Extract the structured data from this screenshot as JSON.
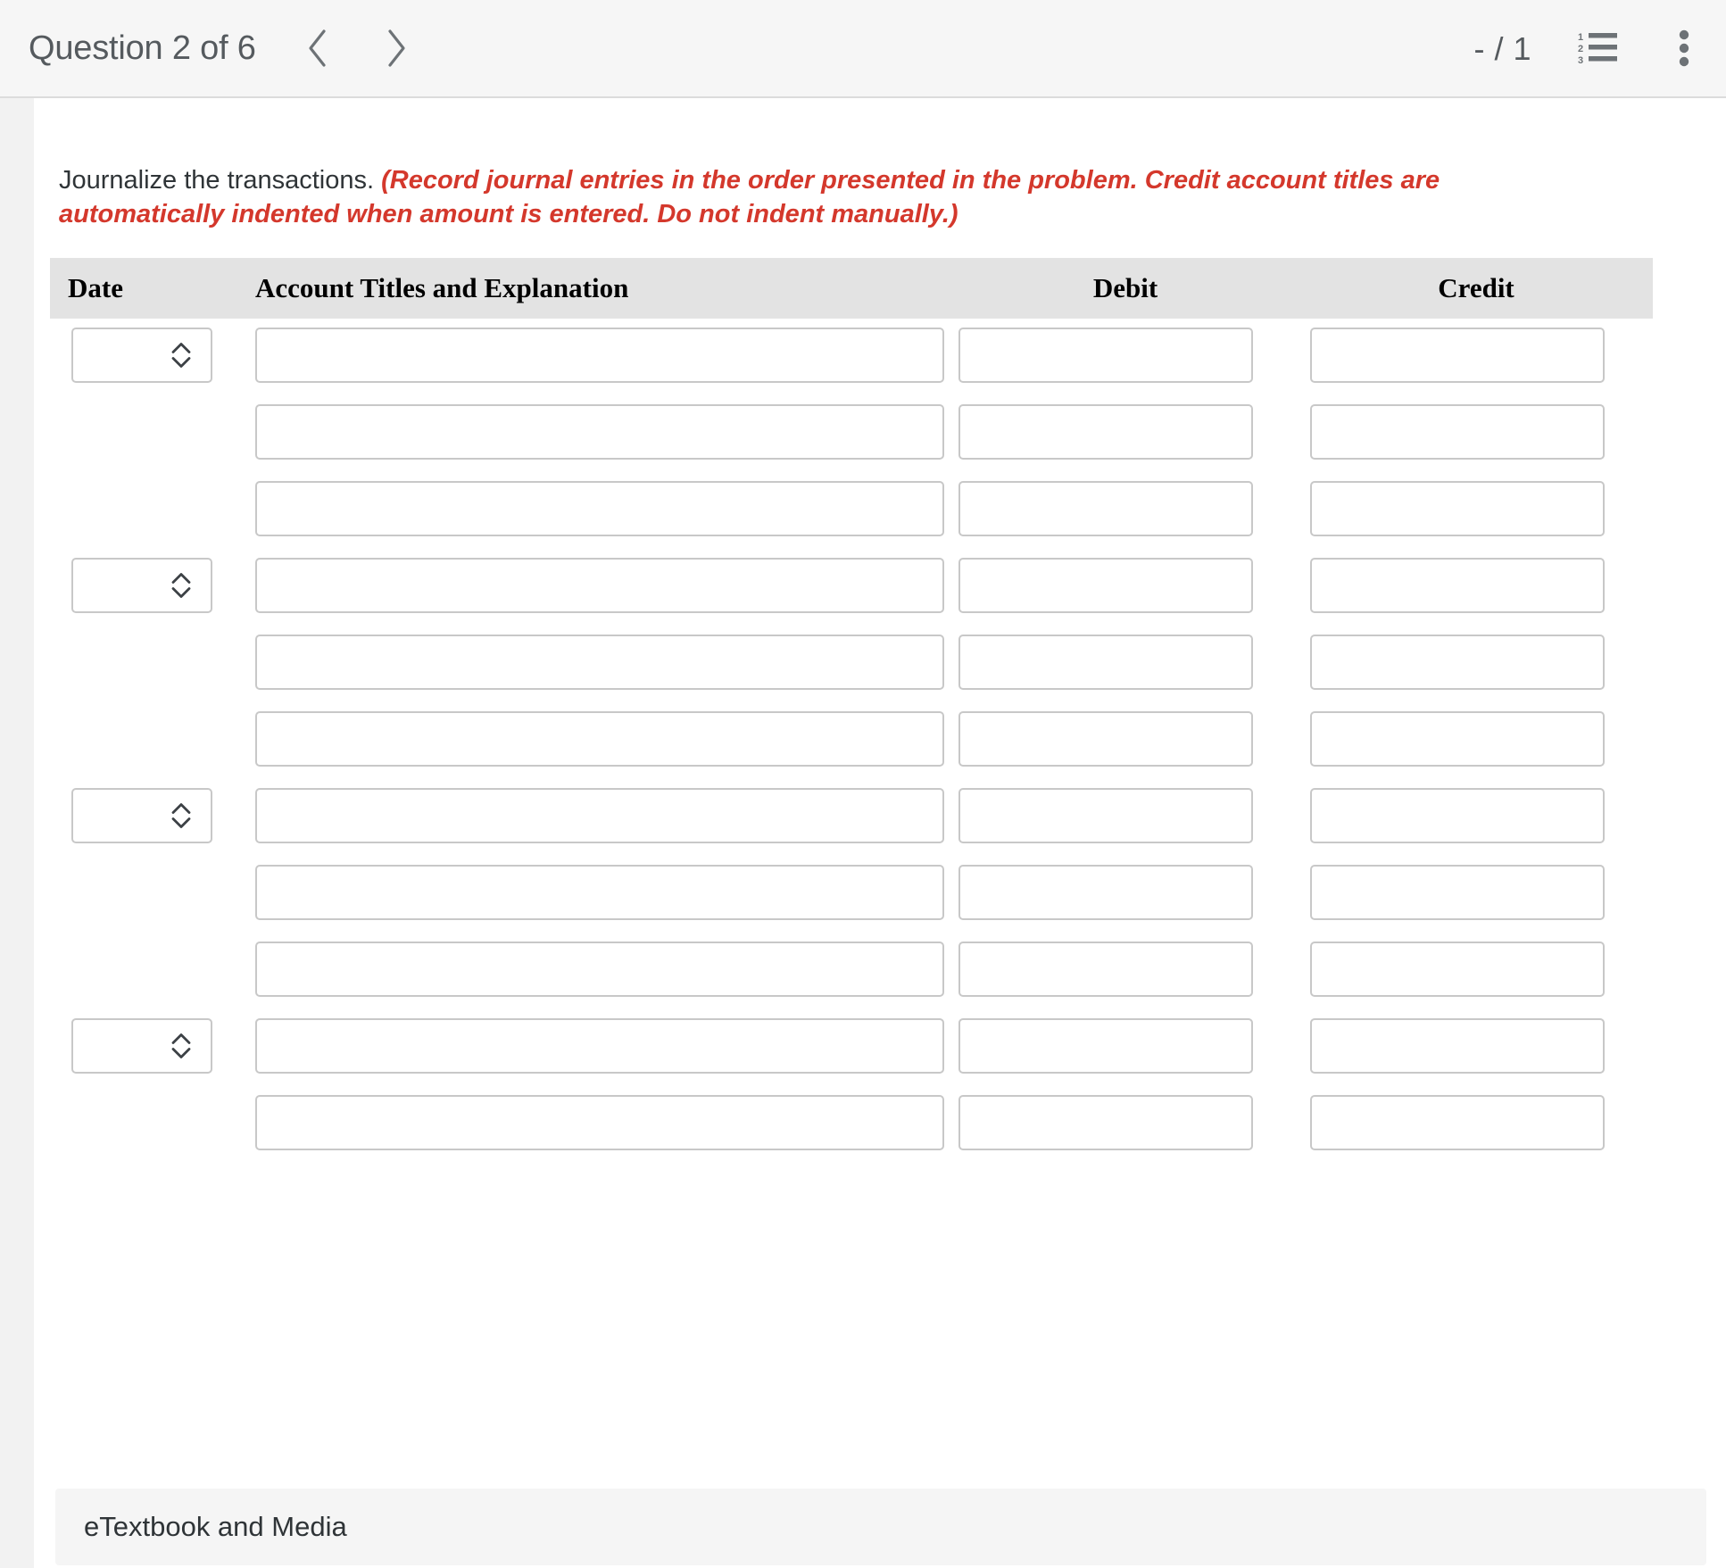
{
  "header": {
    "question_label": "Question 2 of 6",
    "prev_icon": "chevron-left-icon",
    "next_icon": "chevron-right-icon",
    "score": "- / 1",
    "list_icon": "numbered-list-icon",
    "menu_icon": "vertical-dots-icon"
  },
  "prompt": {
    "lead": "Journalize the transactions.",
    "emphasis": "(Record journal entries in the order presented in the problem. Credit account titles are automatically indented when amount is entered. Do not indent manually.)"
  },
  "table": {
    "columns": {
      "date": "Date",
      "account": "Account Titles and Explanation",
      "debit": "Debit",
      "credit": "Credit"
    },
    "rows": [
      {
        "has_date": true,
        "date_value": "",
        "account_value": "",
        "debit_value": "",
        "credit_value": ""
      },
      {
        "has_date": false,
        "date_value": "",
        "account_value": "",
        "debit_value": "",
        "credit_value": ""
      },
      {
        "has_date": false,
        "date_value": "",
        "account_value": "",
        "debit_value": "",
        "credit_value": ""
      },
      {
        "has_date": true,
        "date_value": "",
        "account_value": "",
        "debit_value": "",
        "credit_value": ""
      },
      {
        "has_date": false,
        "date_value": "",
        "account_value": "",
        "debit_value": "",
        "credit_value": ""
      },
      {
        "has_date": false,
        "date_value": "",
        "account_value": "",
        "debit_value": "",
        "credit_value": ""
      },
      {
        "has_date": true,
        "date_value": "",
        "account_value": "",
        "debit_value": "",
        "credit_value": ""
      },
      {
        "has_date": false,
        "date_value": "",
        "account_value": "",
        "debit_value": "",
        "credit_value": ""
      },
      {
        "has_date": false,
        "date_value": "",
        "account_value": "",
        "debit_value": "",
        "credit_value": ""
      },
      {
        "has_date": true,
        "date_value": "",
        "account_value": "",
        "debit_value": "",
        "credit_value": ""
      },
      {
        "has_date": false,
        "date_value": "",
        "account_value": "",
        "debit_value": "",
        "credit_value": ""
      }
    ]
  },
  "footer": {
    "etextbook_label": "eTextbook and Media"
  },
  "colors": {
    "emphasis_red": "#d4382c",
    "header_bg": "#f6f6f6",
    "table_header_bg": "#e3e3e3",
    "input_border": "#c8c8c8",
    "text": "#2f3437",
    "muted_text": "#555a5e",
    "footer_bg": "#f5f5f5",
    "gutter": "#f2f2f2"
  }
}
